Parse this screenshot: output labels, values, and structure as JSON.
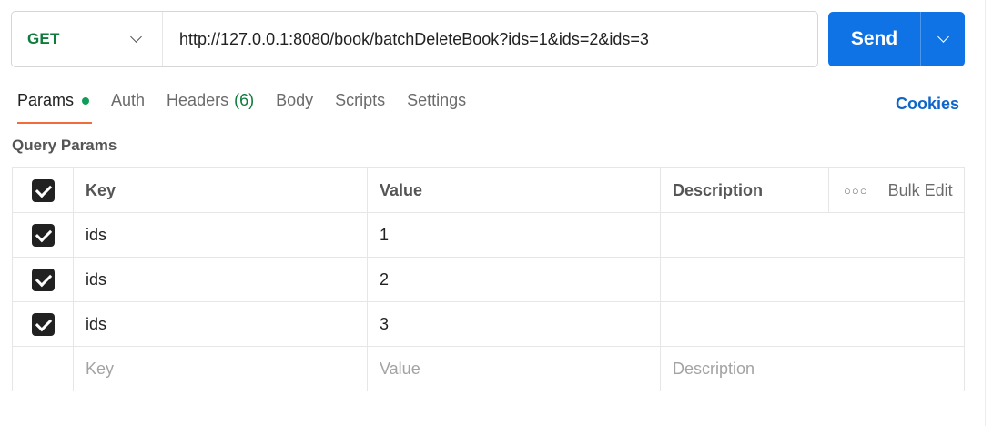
{
  "request": {
    "method": "GET",
    "url": "http://127.0.0.1:8080/book/batchDeleteBook?ids=1&ids=2&ids=3",
    "send_label": "Send",
    "method_color": "#0f7b3c",
    "send_color": "#0f73e6"
  },
  "tabs": [
    {
      "label": "Params"
    },
    {
      "label": "Auth"
    },
    {
      "label": "Headers",
      "count": "(6)"
    },
    {
      "label": "Body"
    },
    {
      "label": "Scripts"
    },
    {
      "label": "Settings"
    }
  ],
  "cookies_label": "Cookies",
  "section_title": "Query Params",
  "table": {
    "headers": {
      "key": "Key",
      "value": "Value",
      "description": "Description",
      "bulk_edit": "Bulk Edit"
    },
    "rows": [
      {
        "key": "ids",
        "value": "1",
        "description": ""
      },
      {
        "key": "ids",
        "value": "2",
        "description": ""
      },
      {
        "key": "ids",
        "value": "3",
        "description": ""
      }
    ],
    "placeholders": {
      "key": "Key",
      "value": "Value",
      "description": "Description"
    }
  }
}
